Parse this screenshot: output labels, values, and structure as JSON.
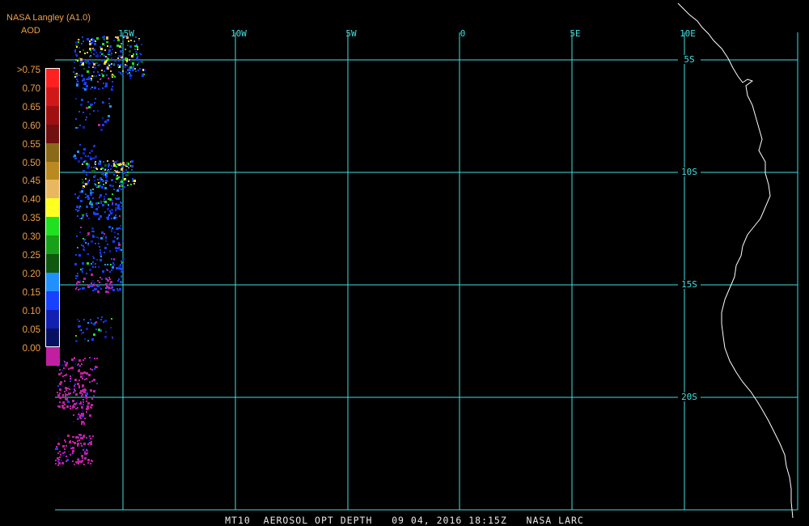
{
  "header": {
    "title": "NASA Langley (A1.0)",
    "subtitle": "AOD"
  },
  "legend": {
    "labels": [
      ">0.75",
      "0.70",
      "0.65",
      "0.60",
      "0.55",
      "0.50",
      "0.45",
      "0.40",
      "0.35",
      "0.30",
      "0.25",
      "0.20",
      "0.15",
      "0.10",
      "0.05",
      "0.00"
    ],
    "colors": [
      "#ff2020",
      "#d01818",
      "#a01010",
      "#701010",
      "#8a6a18",
      "#b88a20",
      "#e8b860",
      "#ffff20",
      "#20e020",
      "#18a018",
      "#105810",
      "#2090ff",
      "#1840ff",
      "#1020b0",
      "#081060",
      "#c020a0"
    ]
  },
  "map": {
    "lon_labels": [
      "15W",
      "10W",
      "5W",
      "0",
      "5E",
      "10E"
    ],
    "lat_labels": [
      "5S",
      "10S",
      "15S",
      "20S"
    ],
    "grid_color": "#40e0e0",
    "coast_color": "#ffffff"
  },
  "footer": {
    "text": "MT10  AEROSOL OPT DEPTH   09 04, 2016 18:15Z   NASA LARC"
  }
}
